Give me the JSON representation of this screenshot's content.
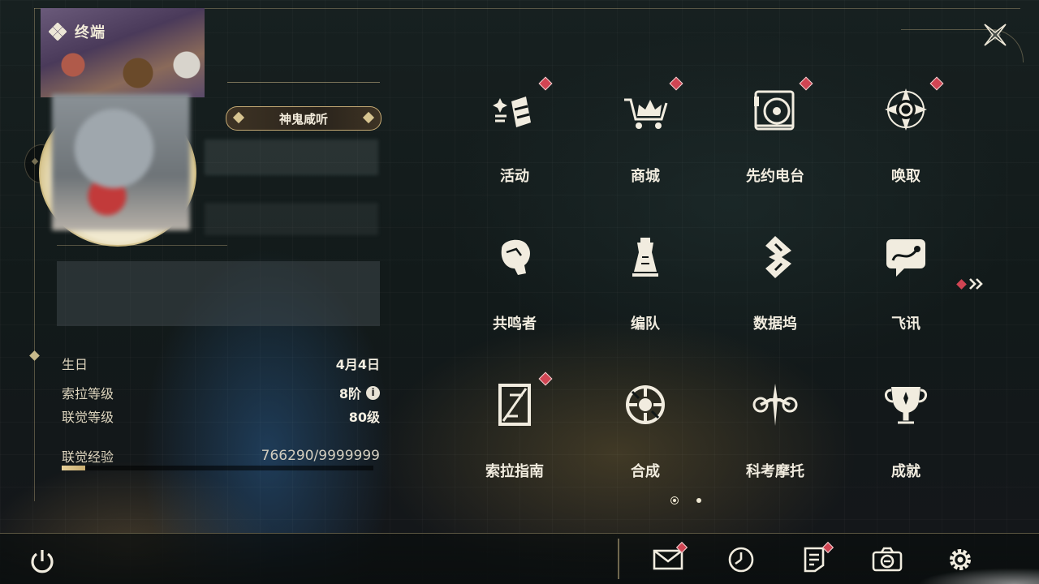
{
  "header": {
    "title": "终端"
  },
  "profile": {
    "title_badge": "神鬼咸听",
    "stats": {
      "birthday_label": "生日",
      "birthday_value": "4月4日",
      "sola_level_label": "索拉等级",
      "sola_level_value": "8阶",
      "info_glyph": "i",
      "union_level_label": "联觉等级",
      "union_level_value": "80级",
      "union_exp_label": "联觉经验",
      "union_exp_value": "766290/9999999",
      "union_exp_fraction": 0.0766
    }
  },
  "grid": [
    {
      "label": "活动",
      "icon": "activity-icon",
      "badge": true
    },
    {
      "label": "商城",
      "icon": "shop-icon",
      "badge": true
    },
    {
      "label": "先约电台",
      "icon": "radio-icon",
      "badge": true
    },
    {
      "label": "唤取",
      "icon": "convene-icon",
      "badge": true
    },
    {
      "label": "共鸣者",
      "icon": "resonator-icon",
      "badge": false
    },
    {
      "label": "编队",
      "icon": "team-icon",
      "badge": false
    },
    {
      "label": "数据坞",
      "icon": "data-dock-icon",
      "badge": false
    },
    {
      "label": "飞讯",
      "icon": "chat-icon",
      "badge": false
    },
    {
      "label": "索拉指南",
      "icon": "guide-icon",
      "badge": true
    },
    {
      "label": "合成",
      "icon": "synthesis-icon",
      "badge": false
    },
    {
      "label": "科考摩托",
      "icon": "motorcycle-icon",
      "badge": false
    },
    {
      "label": "成就",
      "icon": "achievement-icon",
      "badge": false
    }
  ],
  "pager": {
    "current": 1,
    "total": 2
  },
  "bottom_bar": {
    "buttons": [
      {
        "icon": "mail-icon",
        "badge": true
      },
      {
        "icon": "clock-icon",
        "badge": false
      },
      {
        "icon": "notice-icon",
        "badge": true
      },
      {
        "icon": "camera-icon",
        "badge": false
      },
      {
        "icon": "settings-icon",
        "badge": false
      }
    ]
  },
  "colors": {
    "accent_gold": "#d7c490",
    "badge_red": "#d04553",
    "text_light": "#f1ecdf"
  }
}
